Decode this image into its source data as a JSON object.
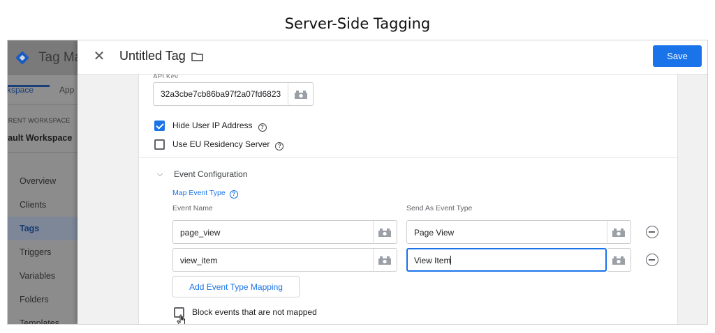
{
  "page": {
    "title": "Server-Side Tagging"
  },
  "background": {
    "app_name": "Tag Ma",
    "tabs": {
      "workspace": "rkspace",
      "admin": "App"
    },
    "current_workspace_label": "RRENT WORKSPACE",
    "current_workspace_name": "fault Workspace",
    "nav": [
      {
        "label": "Overview"
      },
      {
        "label": "Clients"
      },
      {
        "label": "Tags"
      },
      {
        "label": "Triggers"
      },
      {
        "label": "Variables"
      },
      {
        "label": "Folders"
      },
      {
        "label": "Templates"
      }
    ]
  },
  "panel": {
    "title": "Untitled Tag",
    "save_label": "Save",
    "api_label": "API Key",
    "api_key": "32a3cbe7cb86ba97f2a07fd6823",
    "hide_ip": {
      "label": "Hide User IP Address",
      "checked": true
    },
    "eu_server": {
      "label": "Use EU Residency Server",
      "checked": false
    },
    "event_config": {
      "title": "Event Configuration",
      "map_link": "Map Event Type",
      "col_event_name": "Event Name",
      "col_send_as": "Send As Event Type",
      "rows": [
        {
          "event_name": "page_view",
          "send_as": "Page View"
        },
        {
          "event_name": "view_item",
          "send_as": "View Item"
        }
      ],
      "add_label": "Add Event Type Mapping",
      "block_label": "Block events that are not mapped"
    }
  },
  "icons": {
    "close": "close-icon",
    "folder": "folder-icon",
    "help": "help-icon",
    "variable": "variable-picker-icon",
    "remove": "remove-circle-icon",
    "chevron": "chevron-down-icon",
    "cursor": "hand-cursor-icon"
  },
  "colors": {
    "accent": "#1a73e8",
    "logo": "#1a73e8"
  }
}
